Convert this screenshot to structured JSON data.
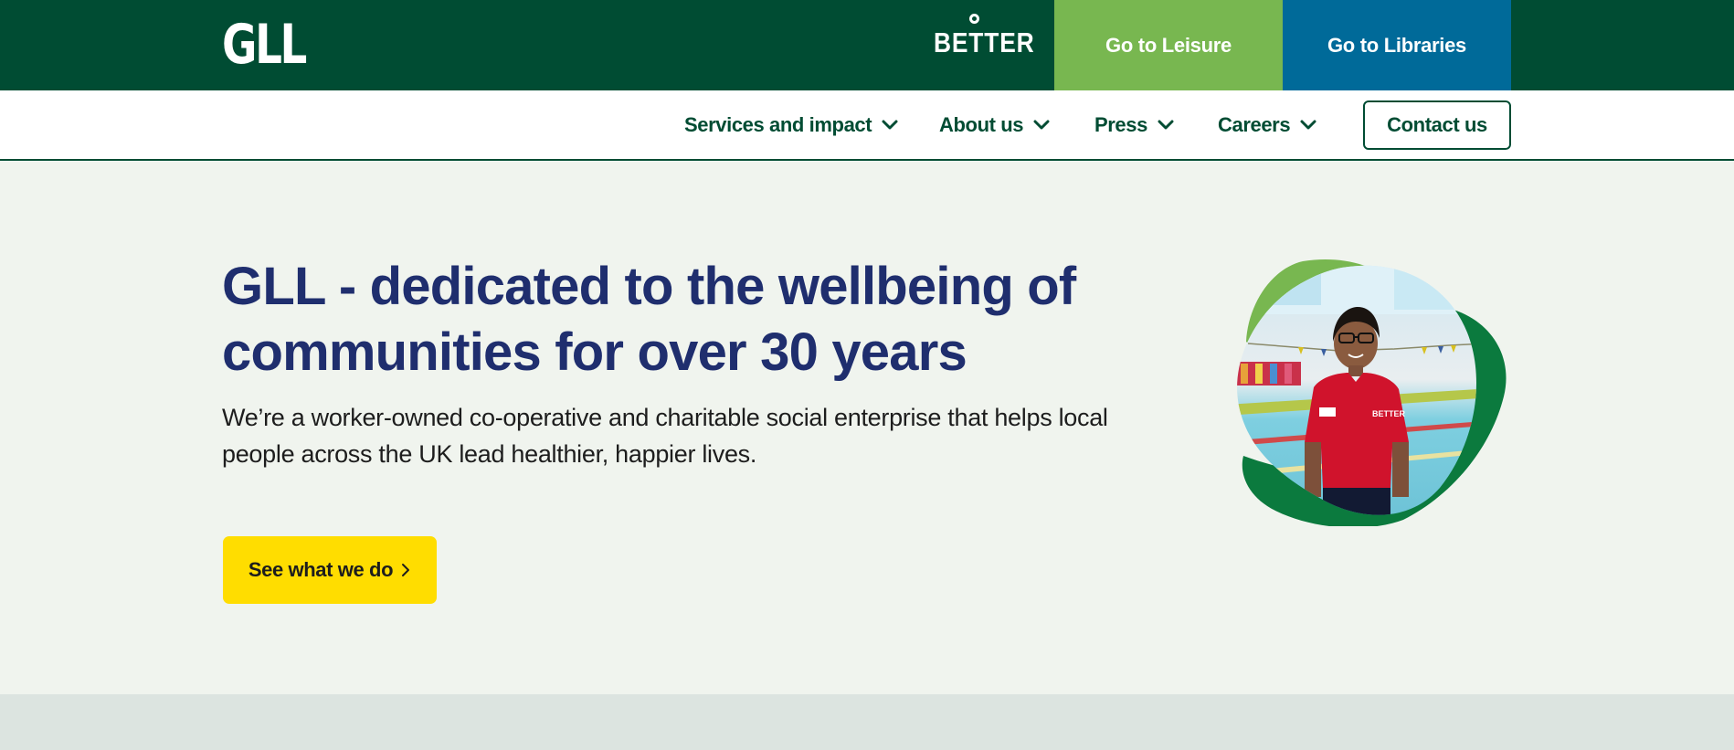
{
  "topbar": {
    "logo_text": "GLL",
    "better_logo_text": "BETTER",
    "leisure_button": "Go to Leisure",
    "libraries_button": "Go to Libraries"
  },
  "nav": {
    "items": [
      {
        "label": "Services and impact"
      },
      {
        "label": "About us"
      },
      {
        "label": "Press"
      },
      {
        "label": "Careers"
      }
    ],
    "contact_button": "Contact us"
  },
  "hero": {
    "title": "GLL - dedicated to the wellbeing of communities for over 30 years",
    "subtitle": "We’re a worker-owned co-operative and charitable social enterprise that helps local people across the UK lead healthier, happier lives.",
    "cta_label": "See what we do",
    "image_alt": "Staff member in red Better polo shirt at a swimming pool"
  },
  "colors": {
    "brand_dark_green": "#004c33",
    "leisure_green": "#78b750",
    "libraries_blue": "#006a99",
    "title_navy": "#1f2e6e",
    "cta_yellow": "#ffdd00",
    "hero_bg": "#f0f4ee"
  },
  "icons": {
    "nav_dropdown": "chevron-down-icon",
    "cta_arrow": "chevron-right-icon"
  }
}
